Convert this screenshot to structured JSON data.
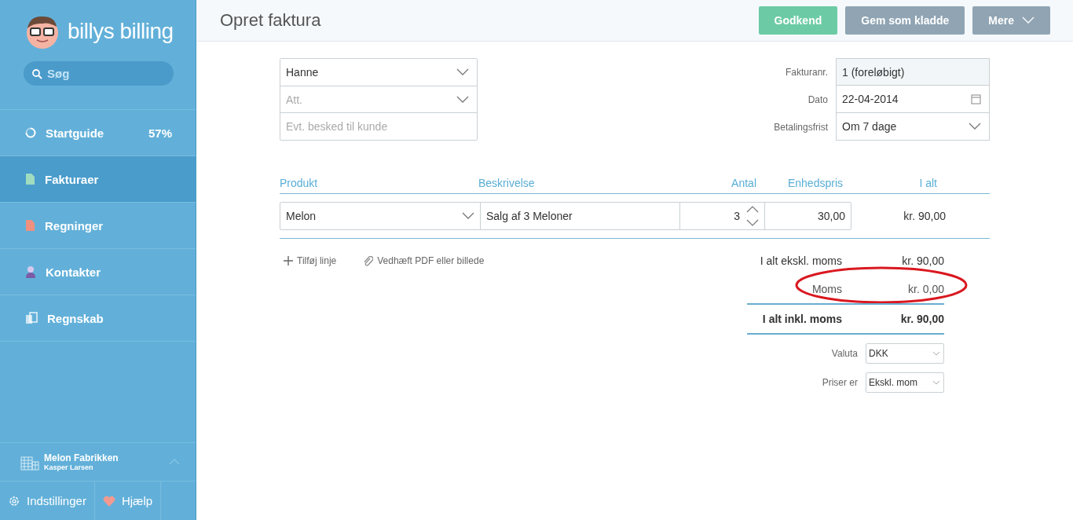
{
  "sidebar": {
    "logo": "billys billing",
    "search": {
      "placeholder": "Søg"
    },
    "items": [
      {
        "label": "Startguide",
        "kind": "progress",
        "badge": "57%",
        "selected": false
      },
      {
        "label": "Fakturaer",
        "kind": "invoice",
        "selected": true
      },
      {
        "label": "Regninger",
        "kind": "bill",
        "selected": false
      },
      {
        "label": "Kontakter",
        "kind": "contact",
        "selected": false
      },
      {
        "label": "Regnskab",
        "kind": "ledger",
        "selected": false
      }
    ],
    "company": {
      "name": "Melon Fabrikken",
      "user": "Kasper Larsen"
    },
    "footer": [
      {
        "label": "Indstillinger",
        "kind": "settings"
      },
      {
        "label": "Hjælp",
        "kind": "help"
      }
    ]
  },
  "header": {
    "title": "Opret faktura",
    "buttons": [
      {
        "label": "Godkend",
        "kind": "primary"
      },
      {
        "label": "Gem som kladde",
        "kind": "secondary"
      },
      {
        "label": "Mere",
        "kind": "dropdown"
      }
    ]
  },
  "customer": [
    {
      "kind": "select",
      "value": "Hanne"
    },
    {
      "kind": "select",
      "placeholder": "Att."
    },
    {
      "kind": "text",
      "placeholder": "Evt. besked til kunde"
    }
  ],
  "meta": [
    {
      "label": "Fakturanr.",
      "kind": "readonly",
      "value": "1 (foreløbigt)"
    },
    {
      "label": "Dato",
      "kind": "date",
      "value": "22-04-2014"
    },
    {
      "label": "Betalingsfrist",
      "kind": "select",
      "value": "Om 7 dage"
    }
  ],
  "lines": {
    "columns": [
      "Produkt",
      "Beskrivelse",
      "Antal",
      "Enhedspris",
      "I alt"
    ],
    "rows": [
      {
        "product": "Melon",
        "description": "Salg af 3 Meloner",
        "quantity": "3",
        "unit_price": "30,00",
        "total": "kr. 90,00"
      }
    ]
  },
  "actions": [
    {
      "label": "Tilføj linje",
      "kind": "add"
    },
    {
      "label": "Vedhæft PDF eller billede",
      "kind": "attach"
    }
  ],
  "totals": [
    {
      "label": "I alt ekskl. moms",
      "value": "kr. 90,00",
      "kind": "subtotal",
      "highlighted": false
    },
    {
      "label": "Moms",
      "value": "kr. 0,00",
      "kind": "tax",
      "highlighted": true
    },
    {
      "label": "I alt inkl. moms",
      "value": "kr. 90,00",
      "kind": "grand",
      "highlighted": false
    }
  ],
  "settings": [
    {
      "label": "Valuta",
      "value": "DKK"
    },
    {
      "label": "Priser er",
      "value": "Ekskl. mom"
    }
  ]
}
